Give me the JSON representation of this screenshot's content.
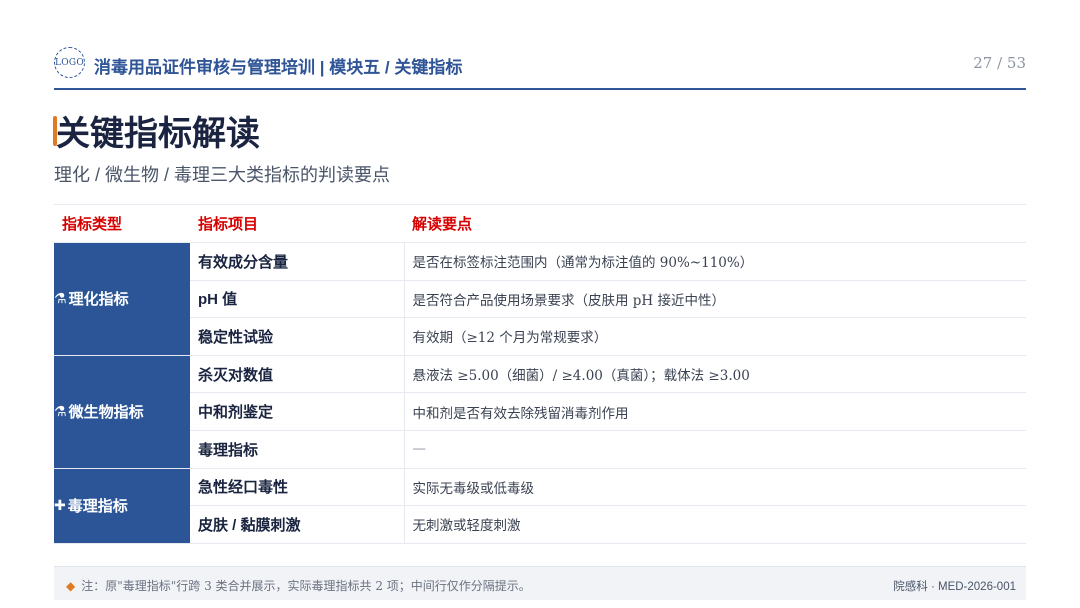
{
  "header": {
    "logo_text": "LOGO",
    "title": "消毒用品证件审核与管理培训 | 模块五 / 关键指标",
    "page_indicator": "27 / 53"
  },
  "page": {
    "title": "关键指标解读",
    "subtitle": "理化 / 微生物 / 毒理三大类指标的判读要点"
  },
  "table": {
    "headers": [
      "指标类型",
      "指标项目",
      "解读要点"
    ],
    "categories": [
      {
        "icon": "test-tube-icon",
        "icon_glyph": "⚗",
        "label": "理化指标"
      },
      {
        "icon": "microbe-icon",
        "icon_glyph": "⚗",
        "label": "微生物指标"
      },
      {
        "icon": "plus-icon",
        "icon_glyph": "✚",
        "label": "毒理指标"
      }
    ],
    "rows": [
      {
        "item": "有效成分含量",
        "desc": "是否在标签标注范围内（通常为标注值的 90%~110%）"
      },
      {
        "item": "pH 值",
        "desc": "是否符合产品使用场景要求（皮肤用 pH 接近中性）"
      },
      {
        "item": "稳定性试验",
        "desc": "有效期（≥12 个月为常规要求）"
      },
      {
        "item": "杀灭对数值",
        "desc": "悬液法 ≥5.00（细菌）/ ≥4.00（真菌）；载体法 ≥3.00"
      },
      {
        "item": "中和剂鉴定",
        "desc": "中和剂是否有效去除残留消毒剂作用"
      },
      {
        "item": "毒理指标",
        "desc": "—"
      },
      {
        "item": "急性经口毒性",
        "desc": "实际无毒级或低毒级"
      },
      {
        "item": "皮肤 / 黏膜刺激",
        "desc": "无刺激或轻度刺激"
      }
    ]
  },
  "footer": {
    "note": "注：原\"毒理指标\"行跨 3 类合并展示，实际毒理指标共 2 项；中间行仅作分隔提示。",
    "code": "院感科 · MED-2026-001"
  },
  "colors": {
    "brand_blue": "#2f5597",
    "category_bg": "#2b5596",
    "header_red": "#d60000",
    "accent_orange": "#e07b24"
  }
}
